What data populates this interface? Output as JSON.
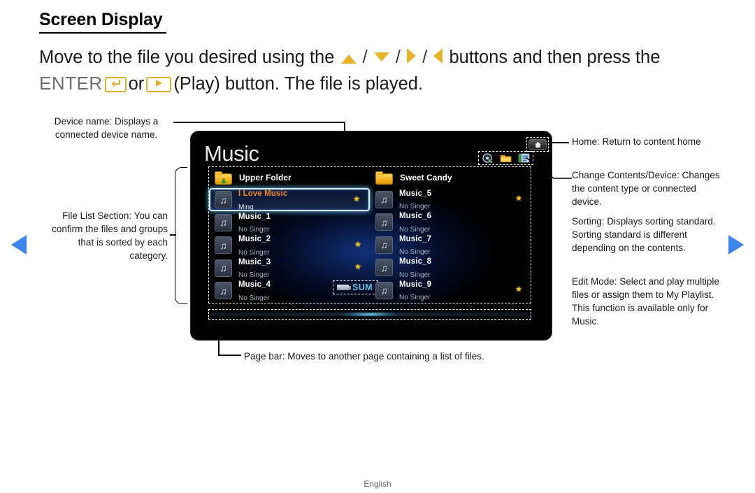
{
  "page": {
    "section_title": "Screen Display",
    "intro_line1_pre": "Move to the file you desired using the",
    "intro_line1_post": "buttons and then press the",
    "intro_enter_word": "ENTER",
    "intro_or": "or",
    "intro_line2_post": "(Play) button. The file is played.",
    "footer_language": "English"
  },
  "tv": {
    "title": "Music",
    "device_name": "SUM",
    "icons": {
      "home": "home-icon",
      "sorting": "sorting-disc-icon",
      "change_contents": "folder-icon",
      "edit_mode": "edit-list-icon"
    },
    "left_column": {
      "folder_label": "Upper Folder",
      "folder_icon": "upper-folder-icon",
      "items": [
        {
          "title": "I Love Music",
          "subtitle": "Ming",
          "starred": true,
          "selected": true
        },
        {
          "title": "Music_1",
          "subtitle": "No Singer",
          "starred": false,
          "selected": false
        },
        {
          "title": "Music_2",
          "subtitle": "No Singer",
          "starred": true,
          "selected": false
        },
        {
          "title": "Music_3",
          "subtitle": "No Singer",
          "starred": true,
          "selected": false
        },
        {
          "title": "Music_4",
          "subtitle": "No Singer",
          "starred": false,
          "selected": false
        }
      ]
    },
    "right_column": {
      "folder_label": "Sweet Candy",
      "folder_icon": "folder-icon",
      "items": [
        {
          "title": "Music_5",
          "subtitle": "No Singer",
          "starred": true,
          "selected": false
        },
        {
          "title": "Music_6",
          "subtitle": "No Singer",
          "starred": false,
          "selected": false
        },
        {
          "title": "Music_7",
          "subtitle": "No Singer",
          "starred": false,
          "selected": false
        },
        {
          "title": "Music_8",
          "subtitle": "No Singer",
          "starred": false,
          "selected": false
        },
        {
          "title": "Music_9",
          "subtitle": "No Singer",
          "starred": true,
          "selected": false
        }
      ]
    },
    "star_glyph": "★"
  },
  "annotations": {
    "device_name": "Device name: Displays a connected device name.",
    "file_list_section": "File List Section: You can confirm the files and groups that is sorted by each category.",
    "home": "Home: Return to content home",
    "change_contents": "Change Contents/Device: Changes the content type or connected device.",
    "sorting": "Sorting: Displays sorting standard. Sorting standard is different depending on the contents.",
    "edit_mode": "Edit Mode: Select and play multiple files or assign them to My Playlist. This function is available only for Music.",
    "page_bar": "Page bar: Moves to another page containing a list of files."
  },
  "colors": {
    "accent_yellow": "#e8b32a",
    "nav_blue": "#3d86f0",
    "device_cyan": "#55c8ef",
    "selected_title_orange": "#ef8a2a",
    "star_gold": "#f2c120"
  }
}
